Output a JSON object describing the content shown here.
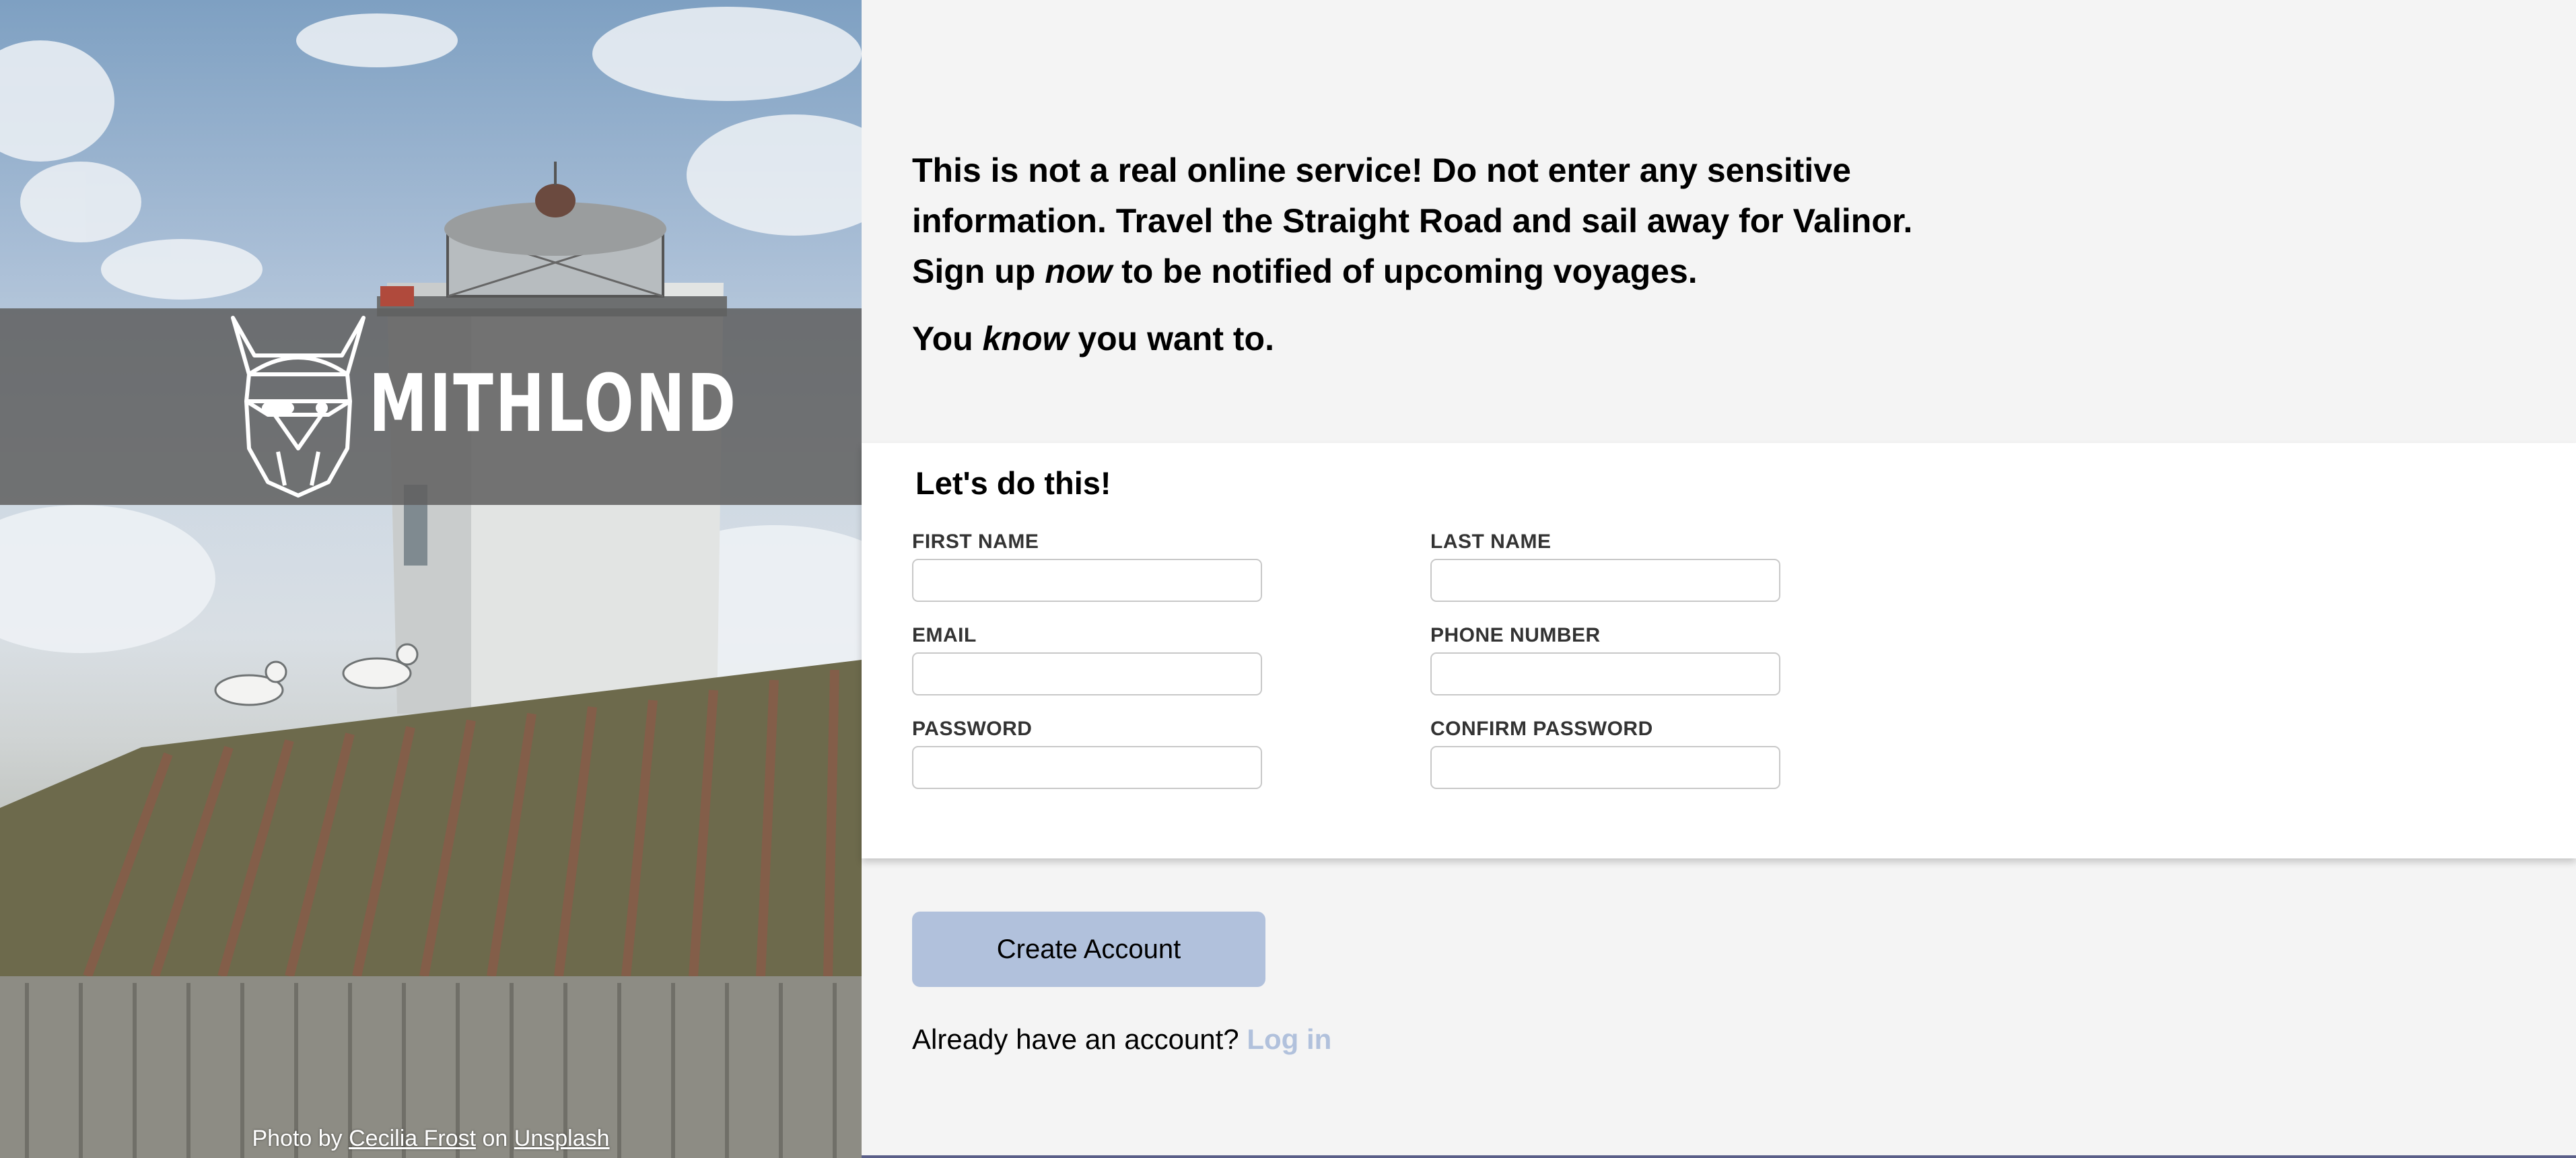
{
  "brand": {
    "name": "MITHLOND",
    "logo_icon": "viking-helmet-icon"
  },
  "photo_credit": {
    "prefix": "Photo by",
    "author": "Cecilia Frost",
    "middle": "on",
    "site": "Unsplash"
  },
  "intro": {
    "line_a": "This is not a real online service! Do not enter any sensitive information. Travel the Straight Road and sail away for Valinor. Sign up ",
    "line_a_em": "now",
    "line_a_end": " to be notified of upcoming voyages.",
    "line_b_start": "You ",
    "line_b_em": "know",
    "line_b_end": " you want to."
  },
  "form": {
    "title": "Let's do this!",
    "fields": {
      "first_name": {
        "label": "FIRST NAME",
        "value": ""
      },
      "last_name": {
        "label": "LAST NAME",
        "value": ""
      },
      "email": {
        "label": "EMAIL",
        "value": ""
      },
      "phone": {
        "label": "PHONE NUMBER",
        "value": ""
      },
      "password": {
        "label": "PASSWORD",
        "value": ""
      },
      "confirm_password": {
        "label": "CONFIRM PASSWORD",
        "value": ""
      }
    }
  },
  "actions": {
    "create_label": "Create Account",
    "login_prompt": "Already have an account?",
    "login_link": "Log in"
  },
  "colors": {
    "accent": "#b1c1dc",
    "page_bg": "#f4f4f4",
    "card_bg": "#ffffff",
    "brand_band": "#5f5f5f"
  }
}
